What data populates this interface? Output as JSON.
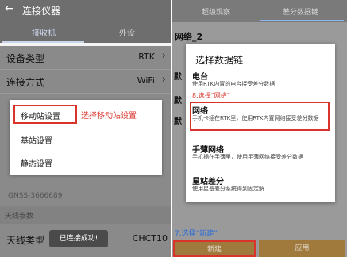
{
  "left": {
    "title": "连接仪器",
    "back_icon": "←",
    "tabs": [
      "接收机",
      "外设"
    ],
    "rows": [
      {
        "label": "设备类型",
        "value": "RTK",
        "chev": "›"
      },
      {
        "label": "连接方式",
        "value": "WiFi",
        "chev": "›"
      }
    ],
    "gnss": "GNSS-3666689",
    "section_title": "天线参数",
    "antenna": {
      "label": "天线类型",
      "value": "CHCT10"
    },
    "popup": {
      "items": [
        "移动站设置",
        "基站设置",
        "静态设置"
      ],
      "annotation": "选择移动站设置"
    },
    "toast": "已连接成功!",
    "colors": {
      "annotation": "#d9342b"
    }
  },
  "right": {
    "tabs": [
      "超级观察",
      "差分数据链"
    ],
    "network_label": "网络_2",
    "side_marks": [
      "默",
      "默",
      "默"
    ],
    "dialog": {
      "title": "选择数据链",
      "options": [
        {
          "name": "电台",
          "desc": "使用RTK内置的电台接受差分数据"
        },
        {
          "name": "网络",
          "desc": "手机卡插在RTK里，使用RTK内置网络接受差分数据"
        },
        {
          "name": "手薄网络",
          "desc": "手机插在手薄里，使用手薄网络接受差分数据"
        },
        {
          "name": "星站差分",
          "desc": "使用星基差分系统得到固定解"
        }
      ],
      "annotation": "8.选择“网络”"
    },
    "bottom_annotation": "7.选择“新建”",
    "buttons": {
      "new": "新建",
      "apply": "应用"
    },
    "colors": {
      "annotation_red": "#d9342b",
      "annotation_blue": "#2e6fd8",
      "button": "#a07a3c"
    }
  }
}
